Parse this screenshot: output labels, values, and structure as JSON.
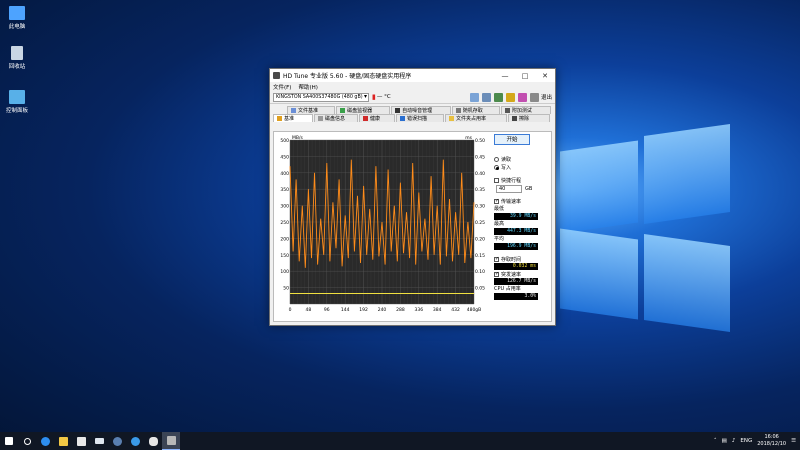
{
  "desktop": {
    "icons": [
      {
        "label": "此电脑",
        "icon": "computer-icon"
      },
      {
        "label": "回收站",
        "icon": "recycle-bin-icon"
      },
      {
        "label": "控制面板",
        "icon": "control-panel-icon"
      }
    ]
  },
  "window": {
    "title": "HD Tune 专业版 5.60 - 硬盘/固态硬盘实用程序",
    "menu": [
      "文件(F)",
      "帮助(H)"
    ],
    "drive": "KINGSTON SA400S37480G (480 gB)",
    "temperature": "— °C",
    "exit_label": "退出",
    "tabs_row1": [
      "文件基准",
      "磁盘监视器",
      "自动噪音管理",
      "随机存取",
      "附加测试"
    ],
    "tabs_row2": [
      "基准",
      "磁盘信息",
      "健康",
      "错误扫描",
      "文件夹占用率",
      "擦除"
    ],
    "active_tab": "基准"
  },
  "panel": {
    "start_label": "开始",
    "read_label": "读取",
    "write_label": "写入",
    "write_selected": true,
    "short_stroke_label": "快捷行程",
    "short_stroke_value": "40",
    "short_stroke_unit": "GB",
    "transfer_rate_label": "传输速率",
    "min_label": "最低",
    "min_value": "39.9 MB/s",
    "max_label": "最高",
    "max_value": "447.3 MB/s",
    "avg_label": "平均",
    "avg_value": "196.9 MB/s",
    "access_time_label": "存取时间",
    "access_time_value": "0.032 ms",
    "burst_rate_label": "突发速率",
    "burst_rate_value": "126.7 MB/s",
    "cpu_label": "CPU 占用率",
    "cpu_value": "3.0%"
  },
  "chart_data": {
    "type": "line",
    "ylabel_left": "MB/s",
    "ylabel_right": "ms",
    "x_unit": "gB",
    "xlim": [
      0,
      480
    ],
    "ylim_left": [
      0,
      500
    ],
    "ylim_right": [
      0,
      0.5
    ],
    "x_ticks": [
      "0",
      "48",
      "96",
      "144",
      "192",
      "240",
      "288",
      "336",
      "384",
      "432",
      "480gB"
    ],
    "y_ticks_left": [
      "500",
      "450",
      "400",
      "350",
      "300",
      "250",
      "200",
      "150",
      "100",
      "50"
    ],
    "y_ticks_right": [
      "0.50",
      "0.45",
      "0.40",
      "0.35",
      "0.30",
      "0.25",
      "0.20",
      "0.15",
      "0.10",
      "0.05"
    ],
    "grid": true,
    "colors": {
      "transfer": "#ff8c1a",
      "access": "#f0e040",
      "background": "#2a2a2a",
      "grid": "#555555"
    },
    "series": [
      {
        "name": "传输速率",
        "x": [
          0,
          8,
          16,
          24,
          32,
          40,
          48,
          56,
          64,
          72,
          80,
          88,
          96,
          104,
          112,
          120,
          128,
          136,
          144,
          152,
          160,
          168,
          176,
          184,
          192,
          200,
          208,
          216,
          224,
          232,
          240,
          248,
          256,
          264,
          272,
          280,
          288,
          296,
          304,
          312,
          320,
          328,
          336,
          344,
          352,
          360,
          368,
          376,
          384,
          392,
          400,
          408,
          416,
          424,
          432,
          440,
          448,
          456,
          464,
          472,
          480
        ],
        "values": [
          420,
          160,
          380,
          130,
          300,
          110,
          350,
          140,
          400,
          120,
          260,
          150,
          430,
          130,
          310,
          170,
          380,
          115,
          270,
          140,
          440,
          160,
          330,
          125,
          360,
          150,
          290,
          135,
          420,
          145,
          250,
          120,
          410,
          160,
          300,
          130,
          370,
          155,
          280,
          140,
          430,
          120,
          340,
          160,
          260,
          135,
          390,
          150,
          300,
          120,
          440,
          145,
          320,
          130,
          280,
          150,
          400,
          125,
          250,
          140,
          310
        ]
      },
      {
        "name": "存取时间",
        "x": [
          0,
          48,
          96,
          144,
          192,
          240,
          288,
          336,
          384,
          432,
          480
        ],
        "values": [
          0.032,
          0.032,
          0.032,
          0.032,
          0.032,
          0.032,
          0.032,
          0.032,
          0.032,
          0.032,
          0.032
        ]
      }
    ]
  },
  "taskbar": {
    "items": [
      "start-icon",
      "search-icon",
      "edge-icon",
      "explorer-icon",
      "store-icon",
      "mail-icon",
      "steam-icon",
      "browser-icon",
      "qq-icon",
      "hdtune-icon"
    ],
    "tray_lang": "ENG",
    "time": "16:06",
    "date": "2018/12/10"
  }
}
